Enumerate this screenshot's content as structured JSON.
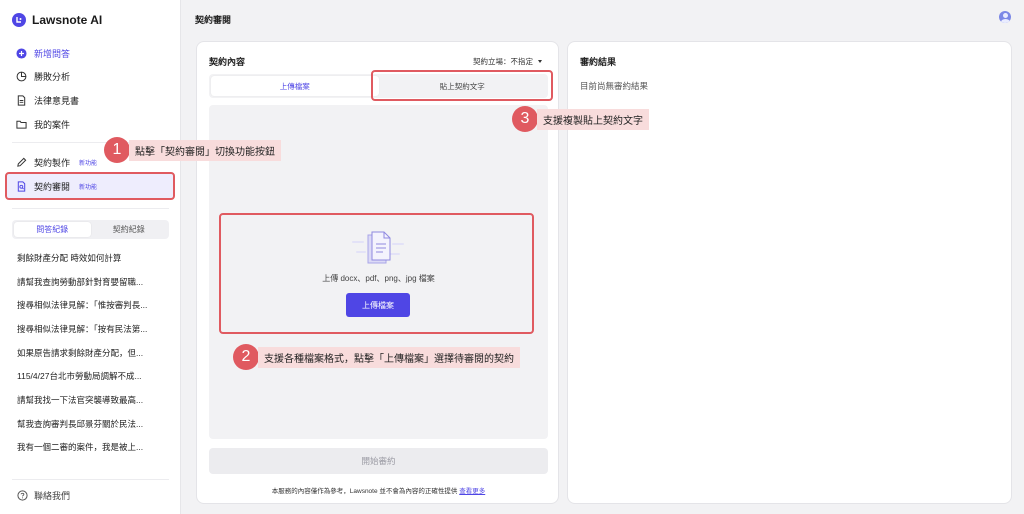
{
  "app": {
    "name": "Lawsnote AI",
    "page_title": "契約審閱"
  },
  "nav": {
    "new_question": "新增問答",
    "win_analysis": "勝敗分析",
    "legal_opinion": "法律意見書",
    "my_cases": "我的案件",
    "contract_draft": "契約製作",
    "contract_draft_badge": "新功能",
    "contract_review": "契約審閱",
    "contract_review_badge": "新功能"
  },
  "history_tabs": {
    "qa": "問答紀錄",
    "contract": "契約紀錄"
  },
  "history_items": [
    "剩餘財產分配 時效如何計算",
    "請幫我查詢勞動部針對育嬰留職...",
    "搜尋相似法律見解：「惟按審判長...",
    "搜尋相似法律見解：「按有民法第...",
    "如果原告請求剩餘財產分配，但...",
    "115/4/27台北市勞動局調解不成...",
    "請幫我找一下法官突襲導致最高...",
    "幫我查詢審判長邱景芬關於民法...",
    "我有一個二審的案件，我是被上..."
  ],
  "contact": "聯絡我們",
  "contract_panel": {
    "title": "契約內容",
    "stance": "契約立場：不指定",
    "tab_upload": "上傳檔案",
    "tab_paste": "貼上契約文字",
    "drop_hint": "上傳 docx、pdf、png、jpg 檔案",
    "upload_button": "上傳檔案",
    "start_button": "開始審約",
    "disclaimer": "本服務的內容僅作為參考，Lawsnote 並不會為內容的正確性提供",
    "disclaimer_link": "查看更多"
  },
  "result_panel": {
    "title": "審約結果",
    "empty": "目前尚無審約結果"
  },
  "annotations": [
    {
      "number": "1",
      "text": "點擊「契約審閱」切換功能按鈕"
    },
    {
      "number": "2",
      "text": "支援各種檔案格式，點擊「上傳檔案」選擇待審閱的契約"
    },
    {
      "number": "3",
      "text": "支援複製貼上契約文字"
    }
  ],
  "colors": {
    "accent": "#4f46e5",
    "annotation": "#e05a60",
    "annotation_bg": "#f8dcdc"
  }
}
